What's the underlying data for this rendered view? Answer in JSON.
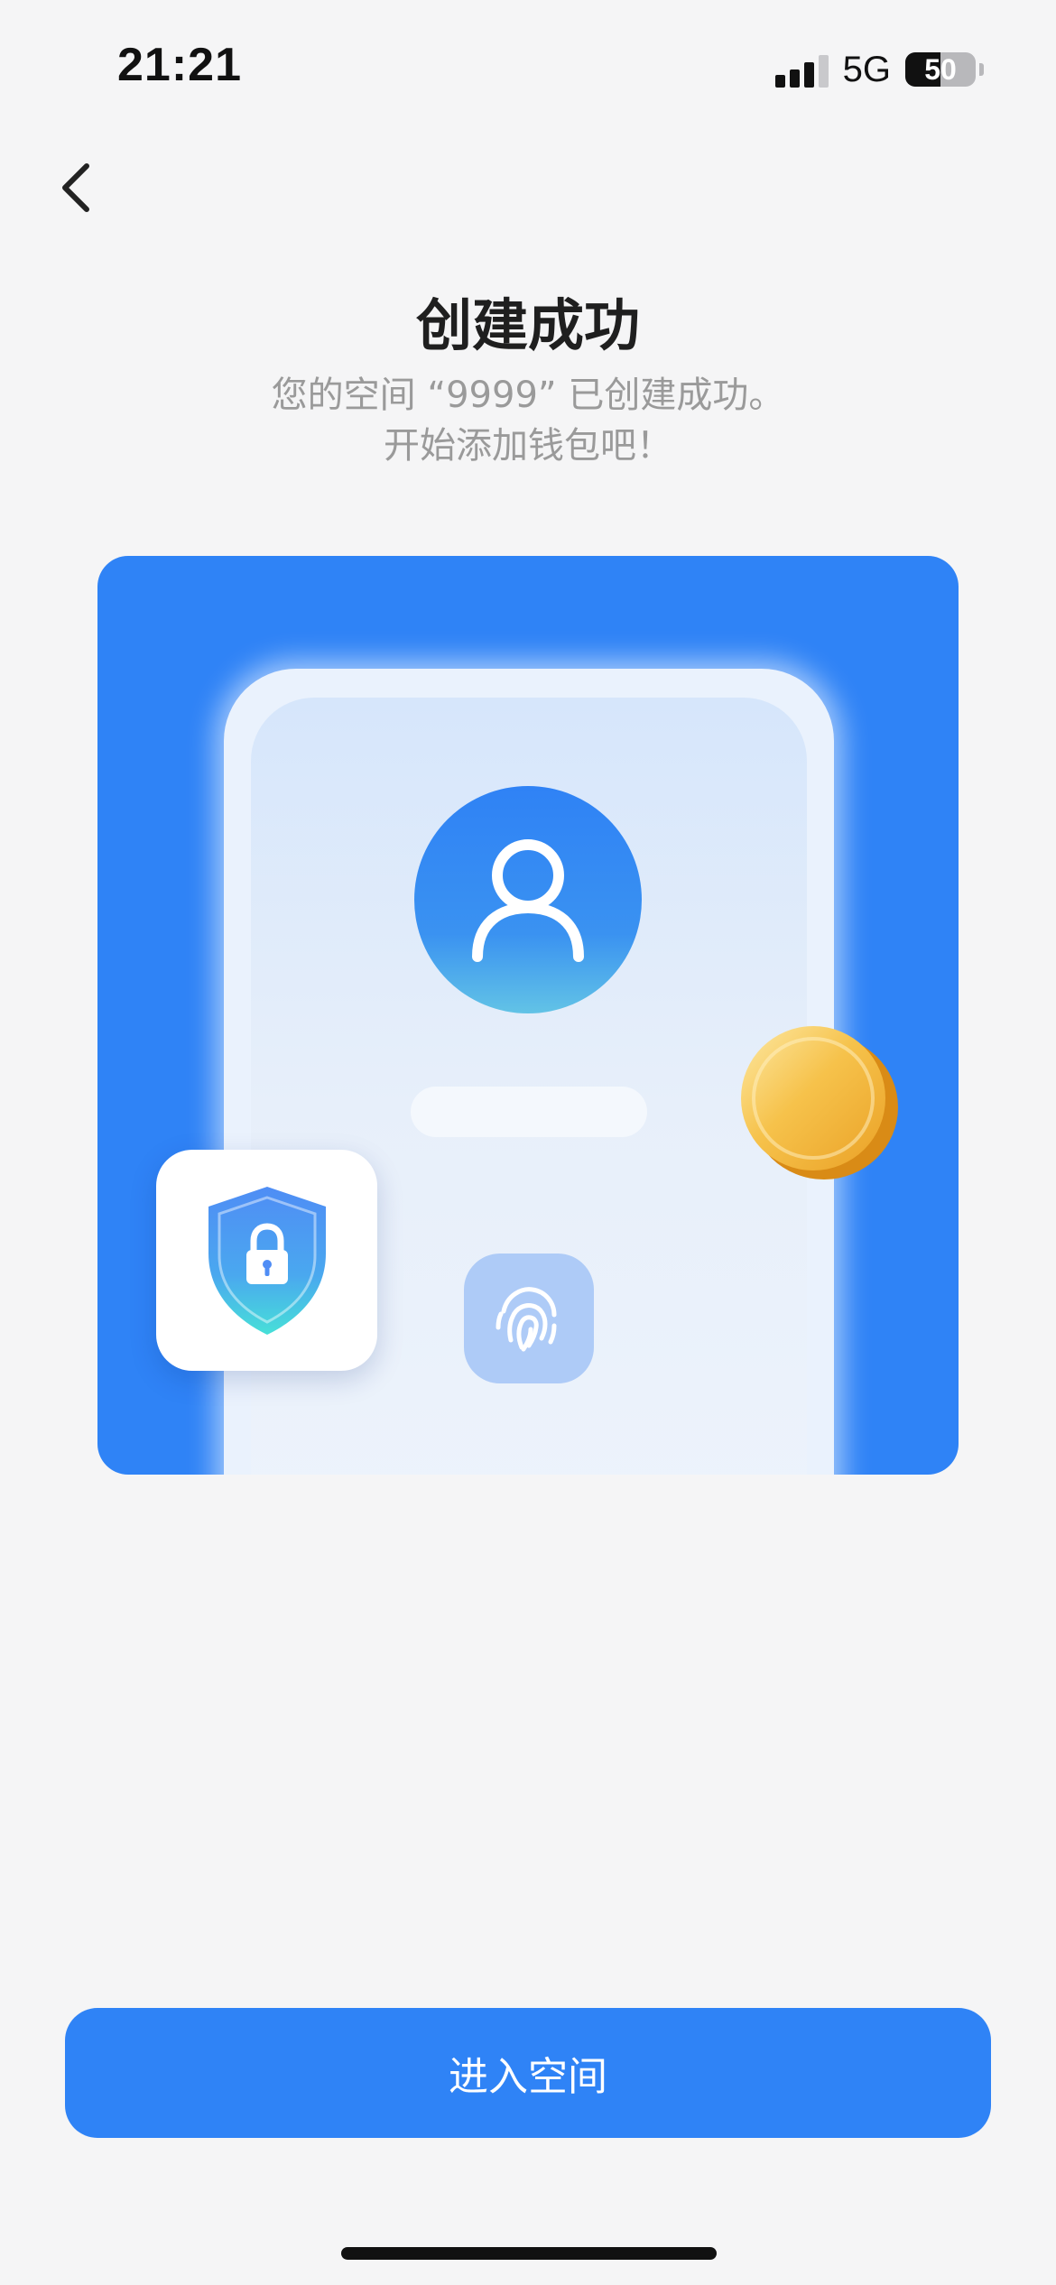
{
  "status_bar": {
    "time": "21:21",
    "network": "5G",
    "battery_level": "50",
    "battery_fraction": 0.5
  },
  "icons": {
    "back": "chevron-left-icon",
    "signal": "signal-bars-icon",
    "battery": "battery-icon",
    "avatar": "user-icon",
    "fingerprint": "fingerprint-icon",
    "shield": "shield-lock-icon",
    "coin": "coin-icon"
  },
  "header": {
    "title": "创建成功",
    "subtitle_line1": "您的空间 “9999” 已创建成功。",
    "subtitle_line2": "开始添加钱包吧！"
  },
  "actions": {
    "enter_space": "进入空间"
  },
  "colors": {
    "accent": "#2f83f6",
    "background": "#f5f5f6",
    "title": "#1f1f1f",
    "subtitle": "#9a9a9a",
    "coin": "#f5b630"
  }
}
